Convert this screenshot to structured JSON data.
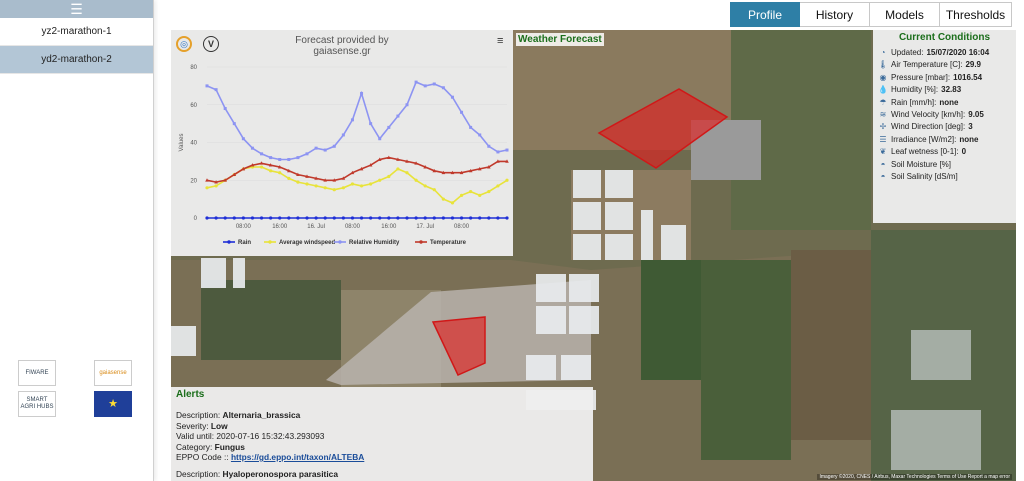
{
  "sidebar": {
    "items": [
      {
        "label": "yz2-marathon-1",
        "active": false
      },
      {
        "label": "yd2-marathon-2",
        "active": true
      }
    ],
    "logos": [
      {
        "name": "fiware-logo",
        "text": "FIWARE"
      },
      {
        "name": "gaiasense-logo",
        "text": "gaiasense"
      },
      {
        "name": "smart-agri-hubs-logo",
        "text": "SMART AGRI HUBS"
      },
      {
        "name": "eu-flag-logo",
        "text": "★"
      }
    ]
  },
  "tabs": [
    {
      "label": "Profile",
      "active": true
    },
    {
      "label": "History",
      "active": false
    },
    {
      "label": "Models",
      "active": false
    },
    {
      "label": "Thresholds",
      "active": false
    }
  ],
  "map": {
    "label": "Weather Forecast",
    "attribution": "Imagery ©2020, CNES / Airbus, Maxar Technologies   Terms of Use   Report a map error"
  },
  "chart_panel": {
    "title_line1": "Forecast provided by",
    "title_line2": "gaiasense.gr"
  },
  "chart_data": {
    "type": "line",
    "title": "Forecast provided by gaiasense.gr",
    "ylabel": "Values",
    "ylim": [
      0,
      80
    ],
    "yticks": [
      0,
      20,
      40,
      60,
      80
    ],
    "x": [
      "15 Jul 00:00",
      "15 Jul 02:00",
      "15 Jul 04:00",
      "15 Jul 06:00",
      "15 Jul 08:00",
      "15 Jul 10:00",
      "15 Jul 12:00",
      "15 Jul 14:00",
      "15 Jul 16:00",
      "15 Jul 18:00",
      "15 Jul 20:00",
      "15 Jul 22:00",
      "16 Jul 00:00",
      "16 Jul 02:00",
      "16 Jul 04:00",
      "16 Jul 06:00",
      "16 Jul 08:00",
      "16 Jul 10:00",
      "16 Jul 12:00",
      "16 Jul 14:00",
      "16 Jul 16:00",
      "16 Jul 18:00",
      "16 Jul 20:00",
      "16 Jul 22:00",
      "17 Jul 00:00",
      "17 Jul 02:00",
      "17 Jul 04:00",
      "17 Jul 06:00",
      "17 Jul 08:00",
      "17 Jul 10:00",
      "17 Jul 12:00",
      "17 Jul 14:00",
      "17 Jul 16:00",
      "17 Jul 18:00"
    ],
    "xticks": [
      {
        "index": 4,
        "label": "08:00"
      },
      {
        "index": 8,
        "label": "16:00"
      },
      {
        "index": 12,
        "label": "16. Jul"
      },
      {
        "index": 16,
        "label": "08:00"
      },
      {
        "index": 20,
        "label": "16:00"
      },
      {
        "index": 24,
        "label": "17. Jul"
      },
      {
        "index": 28,
        "label": "08:00"
      }
    ],
    "legend_position": "bottom",
    "series": [
      {
        "name": "Rain",
        "color": "#1f2fd6",
        "marker": "circle",
        "values": [
          0,
          0,
          0,
          0,
          0,
          0,
          0,
          0,
          0,
          0,
          0,
          0,
          0,
          0,
          0,
          0,
          0,
          0,
          0,
          0,
          0,
          0,
          0,
          0,
          0,
          0,
          0,
          0,
          0,
          0,
          0,
          0,
          0,
          0
        ]
      },
      {
        "name": "Average windspeed",
        "color": "#e8e33a",
        "marker": "circle",
        "values": [
          16,
          17,
          20,
          23,
          26,
          27,
          27,
          25,
          24,
          21,
          19,
          18,
          17,
          16,
          15,
          16,
          18,
          17,
          18,
          20,
          22,
          26,
          24,
          20,
          17,
          15,
          10,
          8,
          12,
          14,
          12,
          14,
          17,
          20
        ]
      },
      {
        "name": "Relative Humidity",
        "color": "#8d94f2",
        "marker": "square",
        "values": [
          70,
          68,
          58,
          50,
          42,
          37,
          34,
          32,
          31,
          31,
          32,
          34,
          37,
          36,
          38,
          44,
          52,
          66,
          50,
          42,
          48,
          54,
          60,
          72,
          70,
          71,
          69,
          64,
          56,
          48,
          44,
          38,
          35,
          36
        ]
      },
      {
        "name": "Temperature",
        "color": "#c0392b",
        "marker": "triangle",
        "values": [
          20,
          19,
          20,
          23,
          26,
          28,
          29,
          28,
          27,
          25,
          23,
          22,
          21,
          20,
          20,
          21,
          24,
          26,
          28,
          31,
          32,
          31,
          30,
          29,
          27,
          25,
          24,
          24,
          24,
          25,
          26,
          27,
          30,
          30
        ]
      }
    ]
  },
  "conditions": {
    "title": "Current Conditions",
    "rows": [
      {
        "icon": "clock-icon",
        "glyph": "◔",
        "label": "Updated:",
        "value": "15/07/2020 16:04"
      },
      {
        "icon": "thermometer-icon",
        "glyph": "🌡",
        "label": "Air Temperature [C]:",
        "value": "29.9"
      },
      {
        "icon": "pressure-icon",
        "glyph": "◉",
        "label": "Pressure [mbar]:",
        "value": "1016.54"
      },
      {
        "icon": "humidity-icon",
        "glyph": "💧",
        "label": "Humidity [%]:",
        "value": "32.83"
      },
      {
        "icon": "rain-icon",
        "glyph": "☂",
        "label": "Rain [mm/h]:",
        "value": "none"
      },
      {
        "icon": "wind-velocity-icon",
        "glyph": "≋",
        "label": "Wind Velocity [km/h]:",
        "value": "9.05"
      },
      {
        "icon": "wind-direction-icon",
        "glyph": "✢",
        "label": "Wind Direction [deg]:",
        "value": "3"
      },
      {
        "icon": "irradiance-icon",
        "glyph": "☰",
        "label": "Irradiance [W/m2]:",
        "value": "none"
      },
      {
        "icon": "leaf-icon",
        "glyph": "❦",
        "label": "Leaf wetness [0-1]:",
        "value": "0"
      },
      {
        "icon": "soil-moisture-icon",
        "glyph": "◓",
        "label": "Soil Moisture [%]",
        "value": ""
      },
      {
        "icon": "soil-salinity-icon",
        "glyph": "◓",
        "label": "Soil Salinity [dS/m]",
        "value": ""
      }
    ]
  },
  "alerts": {
    "title": "Alerts",
    "items": [
      {
        "description_label": "Description:",
        "description": "Alternaria_brassica",
        "severity_label": "Severity:",
        "severity": "Low",
        "valid_label": "Valid until:",
        "valid": "2020-07-16 15:32:43.293093",
        "category_label": "Category:",
        "category": "Fungus",
        "eppo_label": "EPPO Code ::",
        "eppo": "https://gd.eppo.int/taxon/ALTEBA"
      },
      {
        "description_label": "Description:",
        "description": "Hyaloperonospora parasitica"
      }
    ]
  }
}
